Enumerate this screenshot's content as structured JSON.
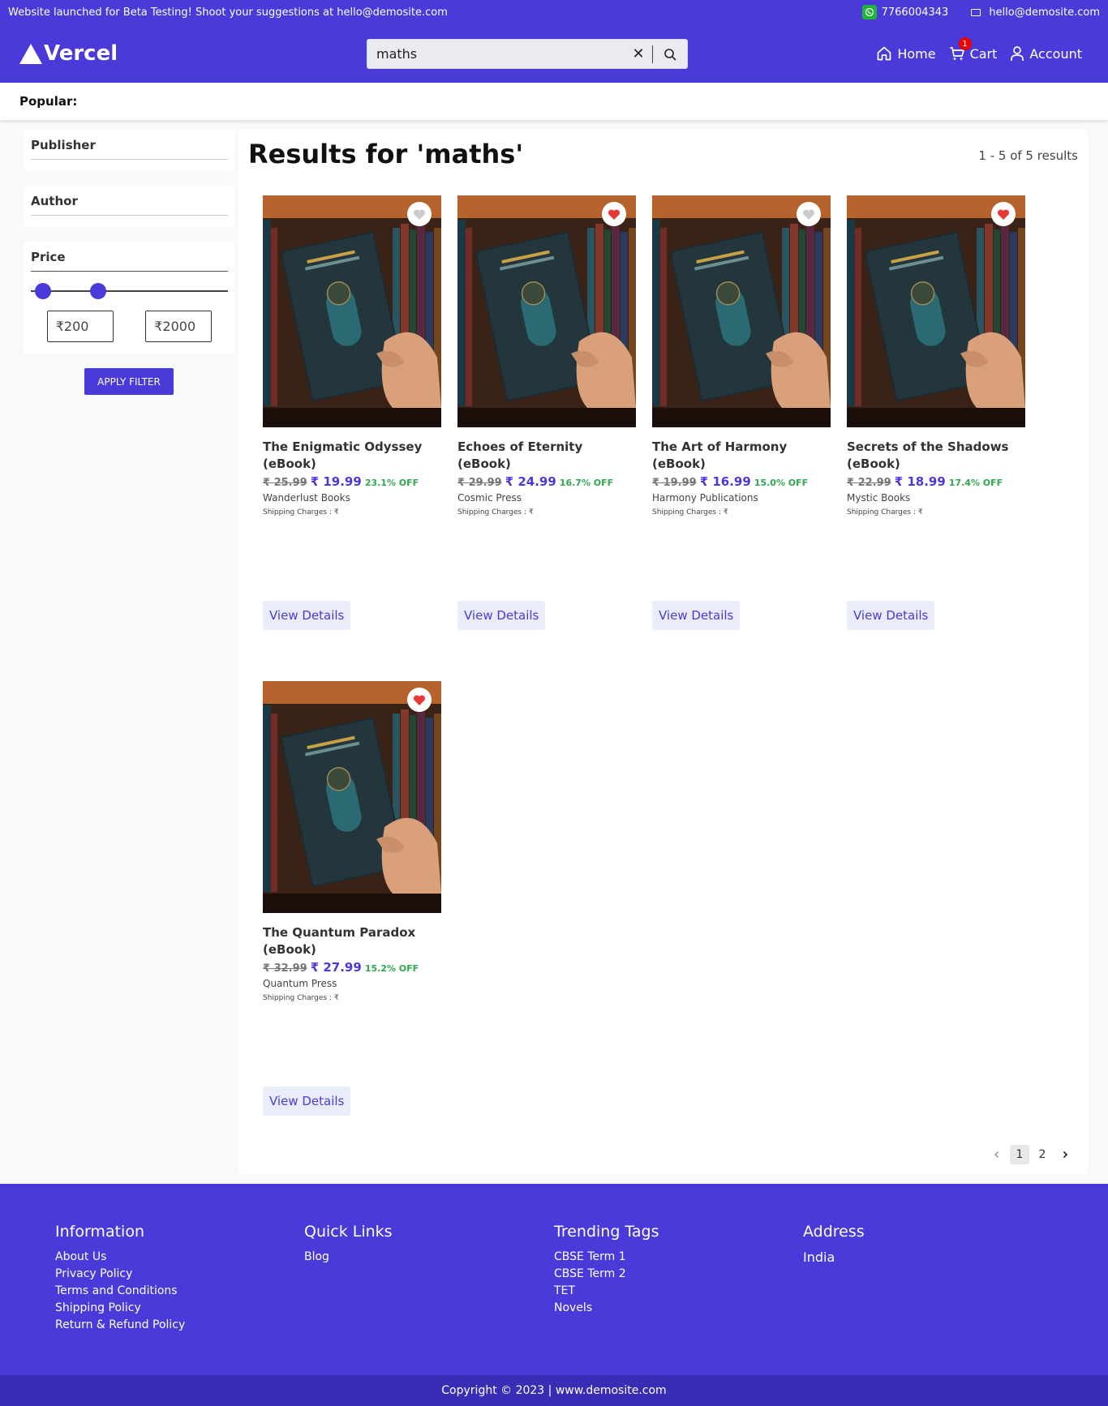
{
  "topbar": {
    "message": "Website launched for Beta Testing! Shoot your suggestions at hello@demosite.com",
    "phone": "7766004343",
    "email": "hello@demosite.com"
  },
  "header": {
    "logo_text": "Vercel",
    "search_value": "maths",
    "clear_symbol": "✕",
    "nav": {
      "home": "Home",
      "cart": "Cart",
      "account": "Account",
      "cart_count": "1"
    }
  },
  "popular_label": "Popular:",
  "filters": {
    "publisher": "Publisher",
    "author": "Author",
    "price": "Price",
    "min_price": "₹200",
    "max_price": "₹2000",
    "apply_label": "APPLY FILTER"
  },
  "results": {
    "title": "Results for 'maths'",
    "count": "1 - 5 of 5 results",
    "view_details_label": "View Details",
    "products": [
      {
        "name": "The Enigmatic Odyssey (eBook)",
        "old_price": "₹ 25.99",
        "new_price": "₹ 19.99",
        "discount": "23.1% OFF",
        "publisher": "Wanderlust Books",
        "shipping": "Shipping Charges : ₹",
        "favorited": false
      },
      {
        "name": "Echoes of Eternity (eBook)",
        "old_price": "₹ 29.99",
        "new_price": "₹ 24.99",
        "discount": "16.7% OFF",
        "publisher": "Cosmic Press",
        "shipping": "Shipping Charges : ₹",
        "favorited": true
      },
      {
        "name": "The Art of Harmony (eBook)",
        "old_price": "₹ 19.99",
        "new_price": "₹ 16.99",
        "discount": "15.0% OFF",
        "publisher": "Harmony Publications",
        "shipping": "Shipping Charges : ₹",
        "favorited": false
      },
      {
        "name": "Secrets of the Shadows (eBook)",
        "old_price": "₹ 22.99",
        "new_price": "₹ 18.99",
        "discount": "17.4% OFF",
        "publisher": "Mystic Books",
        "shipping": "Shipping Charges : ₹",
        "favorited": true
      },
      {
        "name": "The Quantum Paradox (eBook)",
        "old_price": "₹ 32.99",
        "new_price": "₹ 27.99",
        "discount": "15.2% OFF",
        "publisher": "Quantum Press",
        "shipping": "Shipping Charges : ₹",
        "favorited": true
      }
    ],
    "pagination": {
      "pages": [
        "1",
        "2"
      ],
      "current": "1"
    }
  },
  "footer": {
    "information": {
      "title": "Information",
      "links": [
        "About Us",
        "Privacy Policy",
        "Terms and Conditions",
        "Shipping Policy",
        "Return & Refund Policy"
      ]
    },
    "quick_links": {
      "title": "Quick Links",
      "links": [
        "Blog"
      ]
    },
    "trending_tags": {
      "title": "Trending Tags",
      "links": [
        "CBSE Term 1",
        "CBSE Term 2",
        "TET",
        "Novels"
      ]
    },
    "address": {
      "title": "Address",
      "lines": [
        "India"
      ]
    },
    "copyright": "Copyright © 2023 | www.demosite.com"
  },
  "colors": {
    "brand": "#4a3ad9",
    "discount": "#2fa84f",
    "heart": "#e53935"
  }
}
